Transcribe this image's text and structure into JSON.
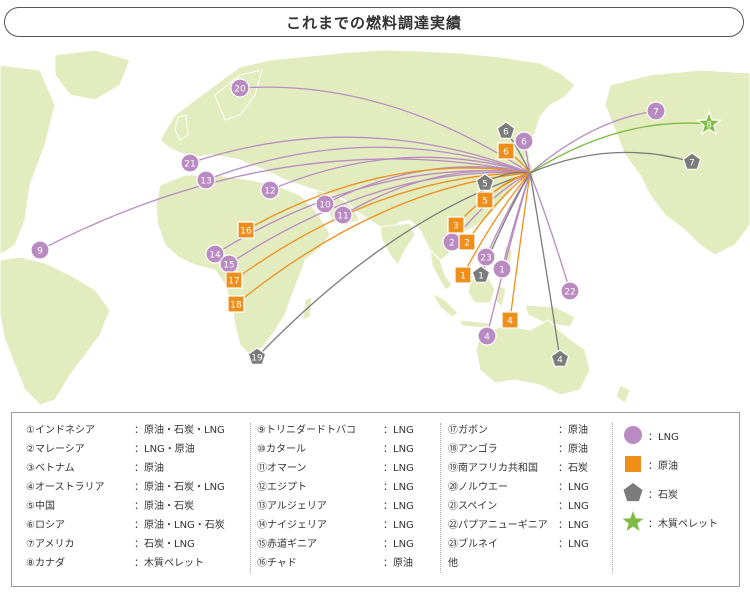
{
  "title": "これまでの燃料調達実績",
  "colors": {
    "lng": "#b98bc2",
    "oil": "#ef8f1b",
    "coal": "#7b7b7b",
    "pellet": "#7dbb43",
    "land": "#e3ecbf",
    "sea": "#ffffff",
    "border": "#ffffff",
    "title_border": "#555555"
  },
  "markers": [
    {
      "kind": "lng",
      "label": "20"
    },
    {
      "kind": "lng",
      "label": "21"
    },
    {
      "kind": "lng",
      "label": "13"
    },
    {
      "kind": "lng",
      "label": "12"
    },
    {
      "kind": "lng",
      "label": "10"
    },
    {
      "kind": "lng",
      "label": "11"
    },
    {
      "kind": "lng",
      "label": "9"
    },
    {
      "kind": "oil",
      "label": "16"
    },
    {
      "kind": "lng",
      "label": "14"
    },
    {
      "kind": "lng",
      "label": "15"
    },
    {
      "kind": "oil",
      "label": "17"
    },
    {
      "kind": "oil",
      "label": "18"
    },
    {
      "kind": "coal",
      "label": "19"
    },
    {
      "kind": "coal",
      "label": "6"
    },
    {
      "kind": "oil",
      "label": "6"
    },
    {
      "kind": "lng",
      "label": "6"
    },
    {
      "kind": "coal",
      "label": "5"
    },
    {
      "kind": "oil",
      "label": "5"
    },
    {
      "kind": "oil",
      "label": "3"
    },
    {
      "kind": "lng",
      "label": "2"
    },
    {
      "kind": "oil",
      "label": "2"
    },
    {
      "kind": "lng",
      "label": "23"
    },
    {
      "kind": "oil",
      "label": "1"
    },
    {
      "kind": "coal",
      "label": "1"
    },
    {
      "kind": "lng",
      "label": "1"
    },
    {
      "kind": "lng",
      "label": "22"
    },
    {
      "kind": "oil",
      "label": "4"
    },
    {
      "kind": "lng",
      "label": "4"
    },
    {
      "kind": "coal",
      "label": "4"
    },
    {
      "kind": "lng",
      "label": "7"
    },
    {
      "kind": "pellet",
      "label": "8"
    },
    {
      "kind": "coal",
      "label": "7"
    }
  ],
  "legend": {
    "col1": [
      {
        "name": "①インドネシア",
        "fuel": "：原油・石炭・LNG"
      },
      {
        "name": "②マレーシア",
        "fuel": "：LNG・原油"
      },
      {
        "name": "③ベトナム",
        "fuel": "：原油"
      },
      {
        "name": "④オーストラリア",
        "fuel": "：原油・石炭・LNG"
      },
      {
        "name": "⑤中国",
        "fuel": "：原油・石炭"
      },
      {
        "name": "⑥ロシア",
        "fuel": "：原油・LNG・石炭"
      },
      {
        "name": "⑦アメリカ",
        "fuel": "：石炭・LNG"
      },
      {
        "name": "⑧カナダ",
        "fuel": "：木質ペレット"
      }
    ],
    "col2": [
      {
        "name": "⑨トリニダードトバコ",
        "fuel": "：LNG"
      },
      {
        "name": "⑩カタール",
        "fuel": "：LNG"
      },
      {
        "name": "⑪オマーン",
        "fuel": "：LNG"
      },
      {
        "name": "⑫エジプト",
        "fuel": "：LNG"
      },
      {
        "name": "⑬アルジェリア",
        "fuel": "：LNG"
      },
      {
        "name": "⑭ナイジェリア",
        "fuel": "：LNG"
      },
      {
        "name": "⑮赤道ギニア",
        "fuel": "：LNG"
      },
      {
        "name": "⑯チャド",
        "fuel": "：原油"
      }
    ],
    "col3": [
      {
        "name": "⑰ガボン",
        "fuel": "：原油"
      },
      {
        "name": "⑱アンゴラ",
        "fuel": "：原油"
      },
      {
        "name": "⑲南アフリカ共和国",
        "fuel": "：石炭"
      },
      {
        "name": "⑳ノルウエー",
        "fuel": "：LNG"
      },
      {
        "name": "㉑スペイン",
        "fuel": "：LNG"
      },
      {
        "name": "㉒パプアニューギニア",
        "fuel": "：LNG"
      },
      {
        "name": "㉓ブルネイ",
        "fuel": "：LNG"
      },
      {
        "name": "他",
        "fuel": ""
      }
    ],
    "symbols": [
      {
        "kind": "lng",
        "label": "：LNG"
      },
      {
        "kind": "oil",
        "label": "：原油"
      },
      {
        "kind": "coal",
        "label": "：石炭"
      },
      {
        "kind": "pellet",
        "label": "：木質ペレット"
      }
    ]
  }
}
